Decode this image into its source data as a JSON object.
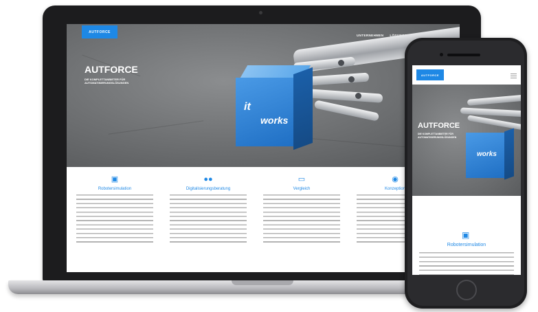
{
  "site": {
    "brand_badge": "AUTFORCE",
    "nav": [
      "UNTERNEHMEN",
      "LÖSUNGEN",
      "REFERENZEN",
      "KONT"
    ],
    "hero_title": "AUTFORCE",
    "hero_subtitle_line1": "DIE KOMPLETTANBIETER FÜR",
    "hero_subtitle_line2": "AUTOMATISIERUNGSLÖSUNGEN",
    "cube_label_small": "it",
    "cube_label_big": "works",
    "features": [
      {
        "icon": "cube-icon",
        "title": "Robotersimulation"
      },
      {
        "icon": "users-icon",
        "title": "Digitalisierungsberatung"
      },
      {
        "icon": "monitor-icon",
        "title": "Vergleich"
      },
      {
        "icon": "network-icon",
        "title": "Konzeption"
      }
    ]
  },
  "phone": {
    "brand_badge": "AUTFORCE",
    "hero_title": "AUTFORCE",
    "hero_subtitle": "DIE KOMPLETTANBIETER FÜR AUTOMATISIERUNGSLÖSUNGEN",
    "feature_title": "Robotersimulation"
  },
  "colors": {
    "accent": "#1e88e5",
    "device": "#1c1c1e"
  }
}
